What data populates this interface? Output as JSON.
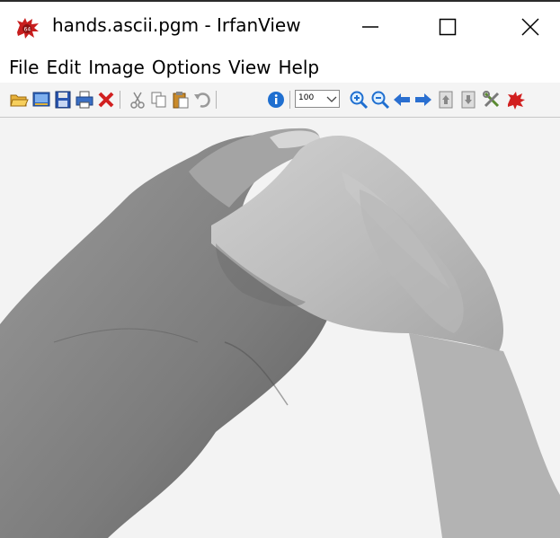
{
  "window": {
    "title": "hands.ascii.pgm - IrfanView",
    "controls": {
      "minimize_icon": "minimize-icon",
      "maximize_icon": "maximize-icon",
      "close_icon": "close-icon"
    }
  },
  "menu": {
    "items": [
      "File",
      "Edit",
      "Image",
      "Options",
      "View",
      "Help"
    ]
  },
  "toolbar": {
    "zoom_value": "100",
    "icons": [
      "open-folder-icon",
      "slideshow-icon",
      "save-icon",
      "print-icon",
      "delete-icon",
      "cut-icon",
      "copy-icon",
      "paste-icon",
      "undo-icon",
      "info-icon",
      "zoom-in-icon",
      "zoom-out-icon",
      "previous-icon",
      "next-icon",
      "first-page-icon",
      "last-page-icon",
      "settings-icon",
      "exit-icon"
    ]
  },
  "image": {
    "description_icon": "grayscale-photo"
  },
  "colors": {
    "accent_red": "#d12020",
    "toolbar_bg": "#f4f4f4",
    "canvas_bg": "#f3f3f3"
  }
}
